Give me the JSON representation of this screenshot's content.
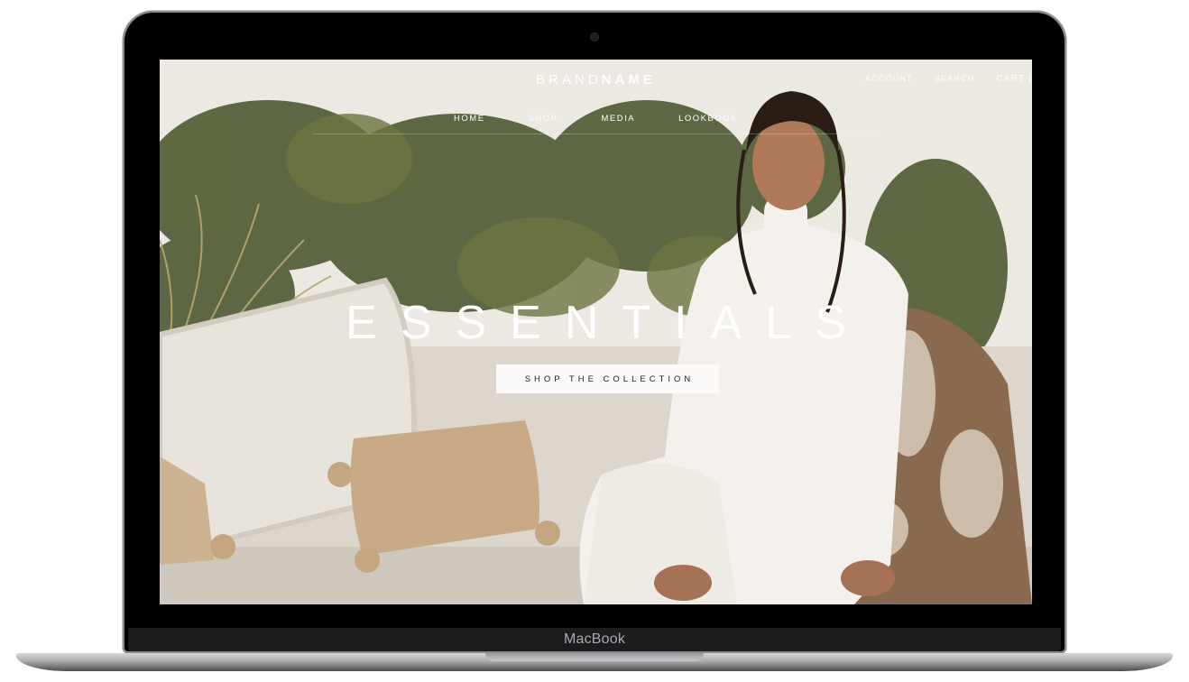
{
  "device": {
    "label": "MacBook"
  },
  "site": {
    "brand": {
      "light": "BRAND",
      "bold": "NAME"
    },
    "utility_links": [
      "ACCOUNT",
      "SEARCH",
      "CART |"
    ],
    "nav": [
      "HOME",
      "SHOP",
      "MEDIA",
      "LOOKBOOK"
    ],
    "hero": {
      "headline": "ESSENTIALS",
      "cta_label": "SHOP THE COLLECTION"
    }
  },
  "colors": {
    "wall": "#efece7",
    "foliage": "#4f5a32",
    "cushion": "#e8e3da",
    "fur": "#8a6a4e",
    "outfit": "#f4f1ec"
  }
}
